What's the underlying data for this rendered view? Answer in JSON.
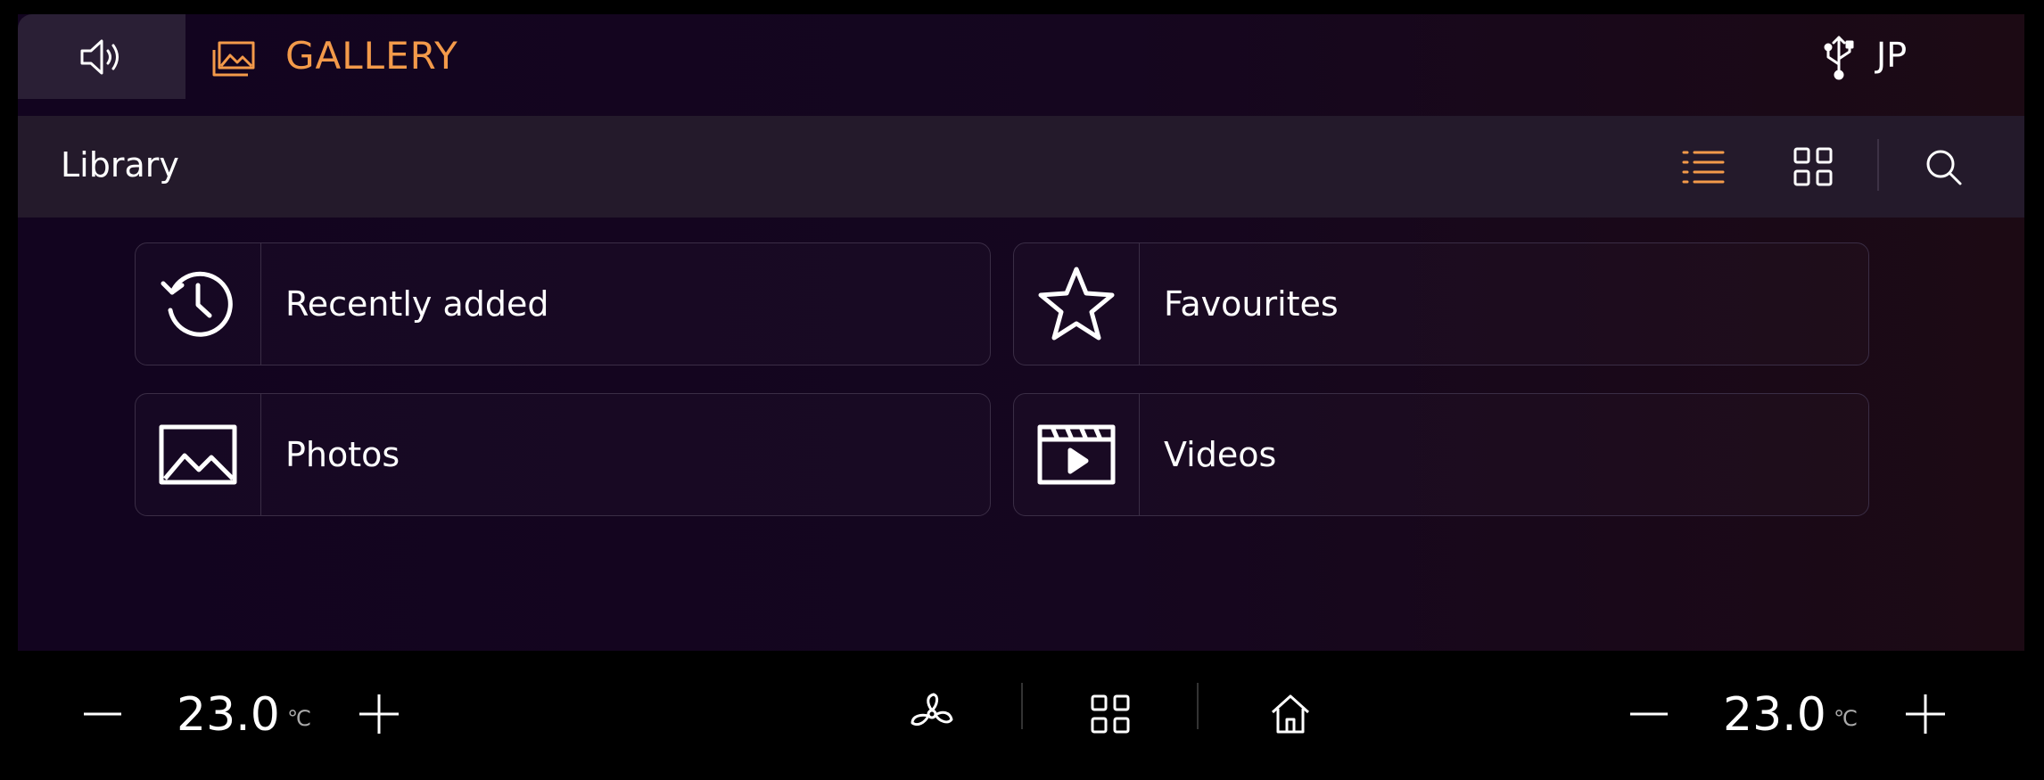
{
  "header": {
    "app_title": "GALLERY",
    "language": "JP"
  },
  "library": {
    "title": "Library"
  },
  "tiles": [
    {
      "label": "Recently added",
      "icon": "history-clock-icon"
    },
    {
      "label": "Favourites",
      "icon": "star-icon"
    },
    {
      "label": "Photos",
      "icon": "photo-icon"
    },
    {
      "label": "Videos",
      "icon": "video-clapper-icon"
    }
  ],
  "climate": {
    "left_temp": "23.0",
    "left_unit": "℃",
    "right_temp": "23.0",
    "right_unit": "℃"
  },
  "colors": {
    "accent": "#f39a4a",
    "background": "#12041f"
  }
}
